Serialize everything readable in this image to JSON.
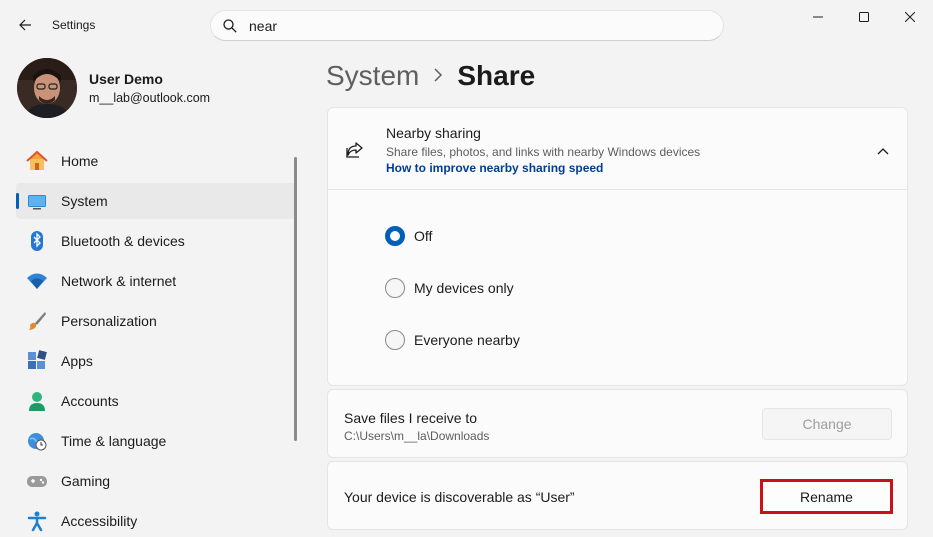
{
  "window": {
    "app_title": "Settings"
  },
  "search": {
    "value": "near",
    "icon": "search-icon"
  },
  "profile": {
    "name": "User Demo",
    "email": "m__lab@outlook.com"
  },
  "sidebar": {
    "items": [
      {
        "label": "Home",
        "icon": "home-icon",
        "active": false
      },
      {
        "label": "System",
        "icon": "system-icon",
        "active": true
      },
      {
        "label": "Bluetooth & devices",
        "icon": "bluetooth-icon",
        "active": false
      },
      {
        "label": "Network & internet",
        "icon": "wifi-icon",
        "active": false
      },
      {
        "label": "Personalization",
        "icon": "brush-icon",
        "active": false
      },
      {
        "label": "Apps",
        "icon": "apps-icon",
        "active": false
      },
      {
        "label": "Accounts",
        "icon": "accounts-icon",
        "active": false
      },
      {
        "label": "Time & language",
        "icon": "globe-clock-icon",
        "active": false
      },
      {
        "label": "Gaming",
        "icon": "gamepad-icon",
        "active": false
      },
      {
        "label": "Accessibility",
        "icon": "accessibility-icon",
        "active": false
      }
    ]
  },
  "breadcrumb": {
    "parent": "System",
    "current": "Share"
  },
  "nearby_sharing": {
    "title": "Nearby sharing",
    "description": "Share files, photos, and links with nearby Windows devices",
    "link": "How to improve nearby sharing speed",
    "options": [
      {
        "label": "Off",
        "selected": true
      },
      {
        "label": "My devices only",
        "selected": false
      },
      {
        "label": "Everyone nearby",
        "selected": false
      }
    ]
  },
  "save_files": {
    "title": "Save files I receive to",
    "path": "C:\\Users\\m__la\\Downloads",
    "button": "Change"
  },
  "device": {
    "text": "Your device is discoverable as “User”",
    "button": "Rename"
  },
  "colors": {
    "accent": "#005fb8",
    "highlight_border": "#c8111a",
    "link": "#003e92"
  }
}
